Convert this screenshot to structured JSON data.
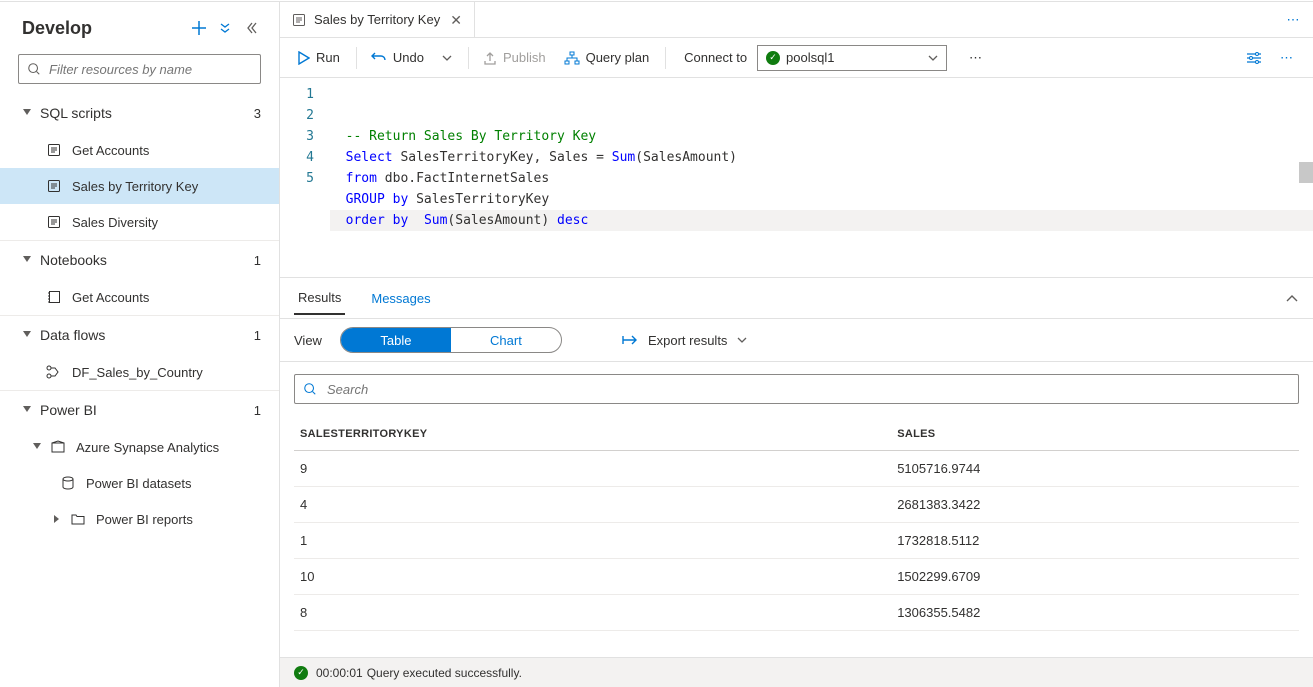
{
  "sidebar": {
    "title": "Develop",
    "filter_placeholder": "Filter resources by name",
    "sections": {
      "sql": {
        "label": "SQL scripts",
        "count": "3",
        "items": [
          "Get Accounts",
          "Sales by Territory Key",
          "Sales Diversity"
        ],
        "active_index": 1
      },
      "notebooks": {
        "label": "Notebooks",
        "count": "1",
        "items": [
          "Get Accounts"
        ]
      },
      "dataflows": {
        "label": "Data flows",
        "count": "1",
        "items": [
          "DF_Sales_by_Country"
        ]
      },
      "powerbi": {
        "label": "Power BI",
        "count": "1",
        "group": "Azure Synapse Analytics",
        "datasets": "Power BI datasets",
        "reports": "Power BI reports"
      }
    }
  },
  "tab": {
    "label": "Sales by Territory Key"
  },
  "toolbar": {
    "run": "Run",
    "undo": "Undo",
    "publish": "Publish",
    "queryplan": "Query plan",
    "connect_to": "Connect to",
    "pool": "poolsql1"
  },
  "editor": {
    "lines": [
      {
        "n": "1",
        "segs": [
          {
            "t": "  ",
            "c": ""
          },
          {
            "t": "-- Return Sales By Territory Key",
            "c": "cm"
          }
        ]
      },
      {
        "n": "2",
        "segs": [
          {
            "t": "  ",
            "c": ""
          },
          {
            "t": "Select",
            "c": "kw"
          },
          {
            "t": " SalesTerritoryKey, Sales = ",
            "c": ""
          },
          {
            "t": "Sum",
            "c": "kw"
          },
          {
            "t": "(SalesAmount)",
            "c": ""
          }
        ]
      },
      {
        "n": "3",
        "segs": [
          {
            "t": "  ",
            "c": ""
          },
          {
            "t": "from",
            "c": "kw"
          },
          {
            "t": " dbo.FactInternetSales",
            "c": ""
          }
        ]
      },
      {
        "n": "4",
        "segs": [
          {
            "t": "  ",
            "c": ""
          },
          {
            "t": "GROUP",
            "c": "kw"
          },
          {
            "t": " ",
            "c": ""
          },
          {
            "t": "by",
            "c": "kw"
          },
          {
            "t": " SalesTerritoryKey",
            "c": ""
          }
        ]
      },
      {
        "n": "5",
        "segs": [
          {
            "t": "  ",
            "c": ""
          },
          {
            "t": "order",
            "c": "kw"
          },
          {
            "t": " ",
            "c": ""
          },
          {
            "t": "by",
            "c": "kw"
          },
          {
            "t": "  ",
            "c": ""
          },
          {
            "t": "Sum",
            "c": "kw"
          },
          {
            "t": "(SalesAmount) ",
            "c": ""
          },
          {
            "t": "desc",
            "c": "kw"
          }
        ]
      }
    ]
  },
  "results": {
    "tab_results": "Results",
    "tab_messages": "Messages",
    "view_label": "View",
    "seg_table": "Table",
    "seg_chart": "Chart",
    "export": "Export results",
    "search_placeholder": "Search",
    "columns": [
      "SALESTERRITORYKEY",
      "SALES"
    ],
    "rows": [
      [
        "9",
        "5105716.9744"
      ],
      [
        "4",
        "2681383.3422"
      ],
      [
        "1",
        "1732818.5112"
      ],
      [
        "10",
        "1502299.6709"
      ],
      [
        "8",
        "1306355.5482"
      ]
    ]
  },
  "status": {
    "time": "00:00:01",
    "msg": "Query executed successfully."
  }
}
